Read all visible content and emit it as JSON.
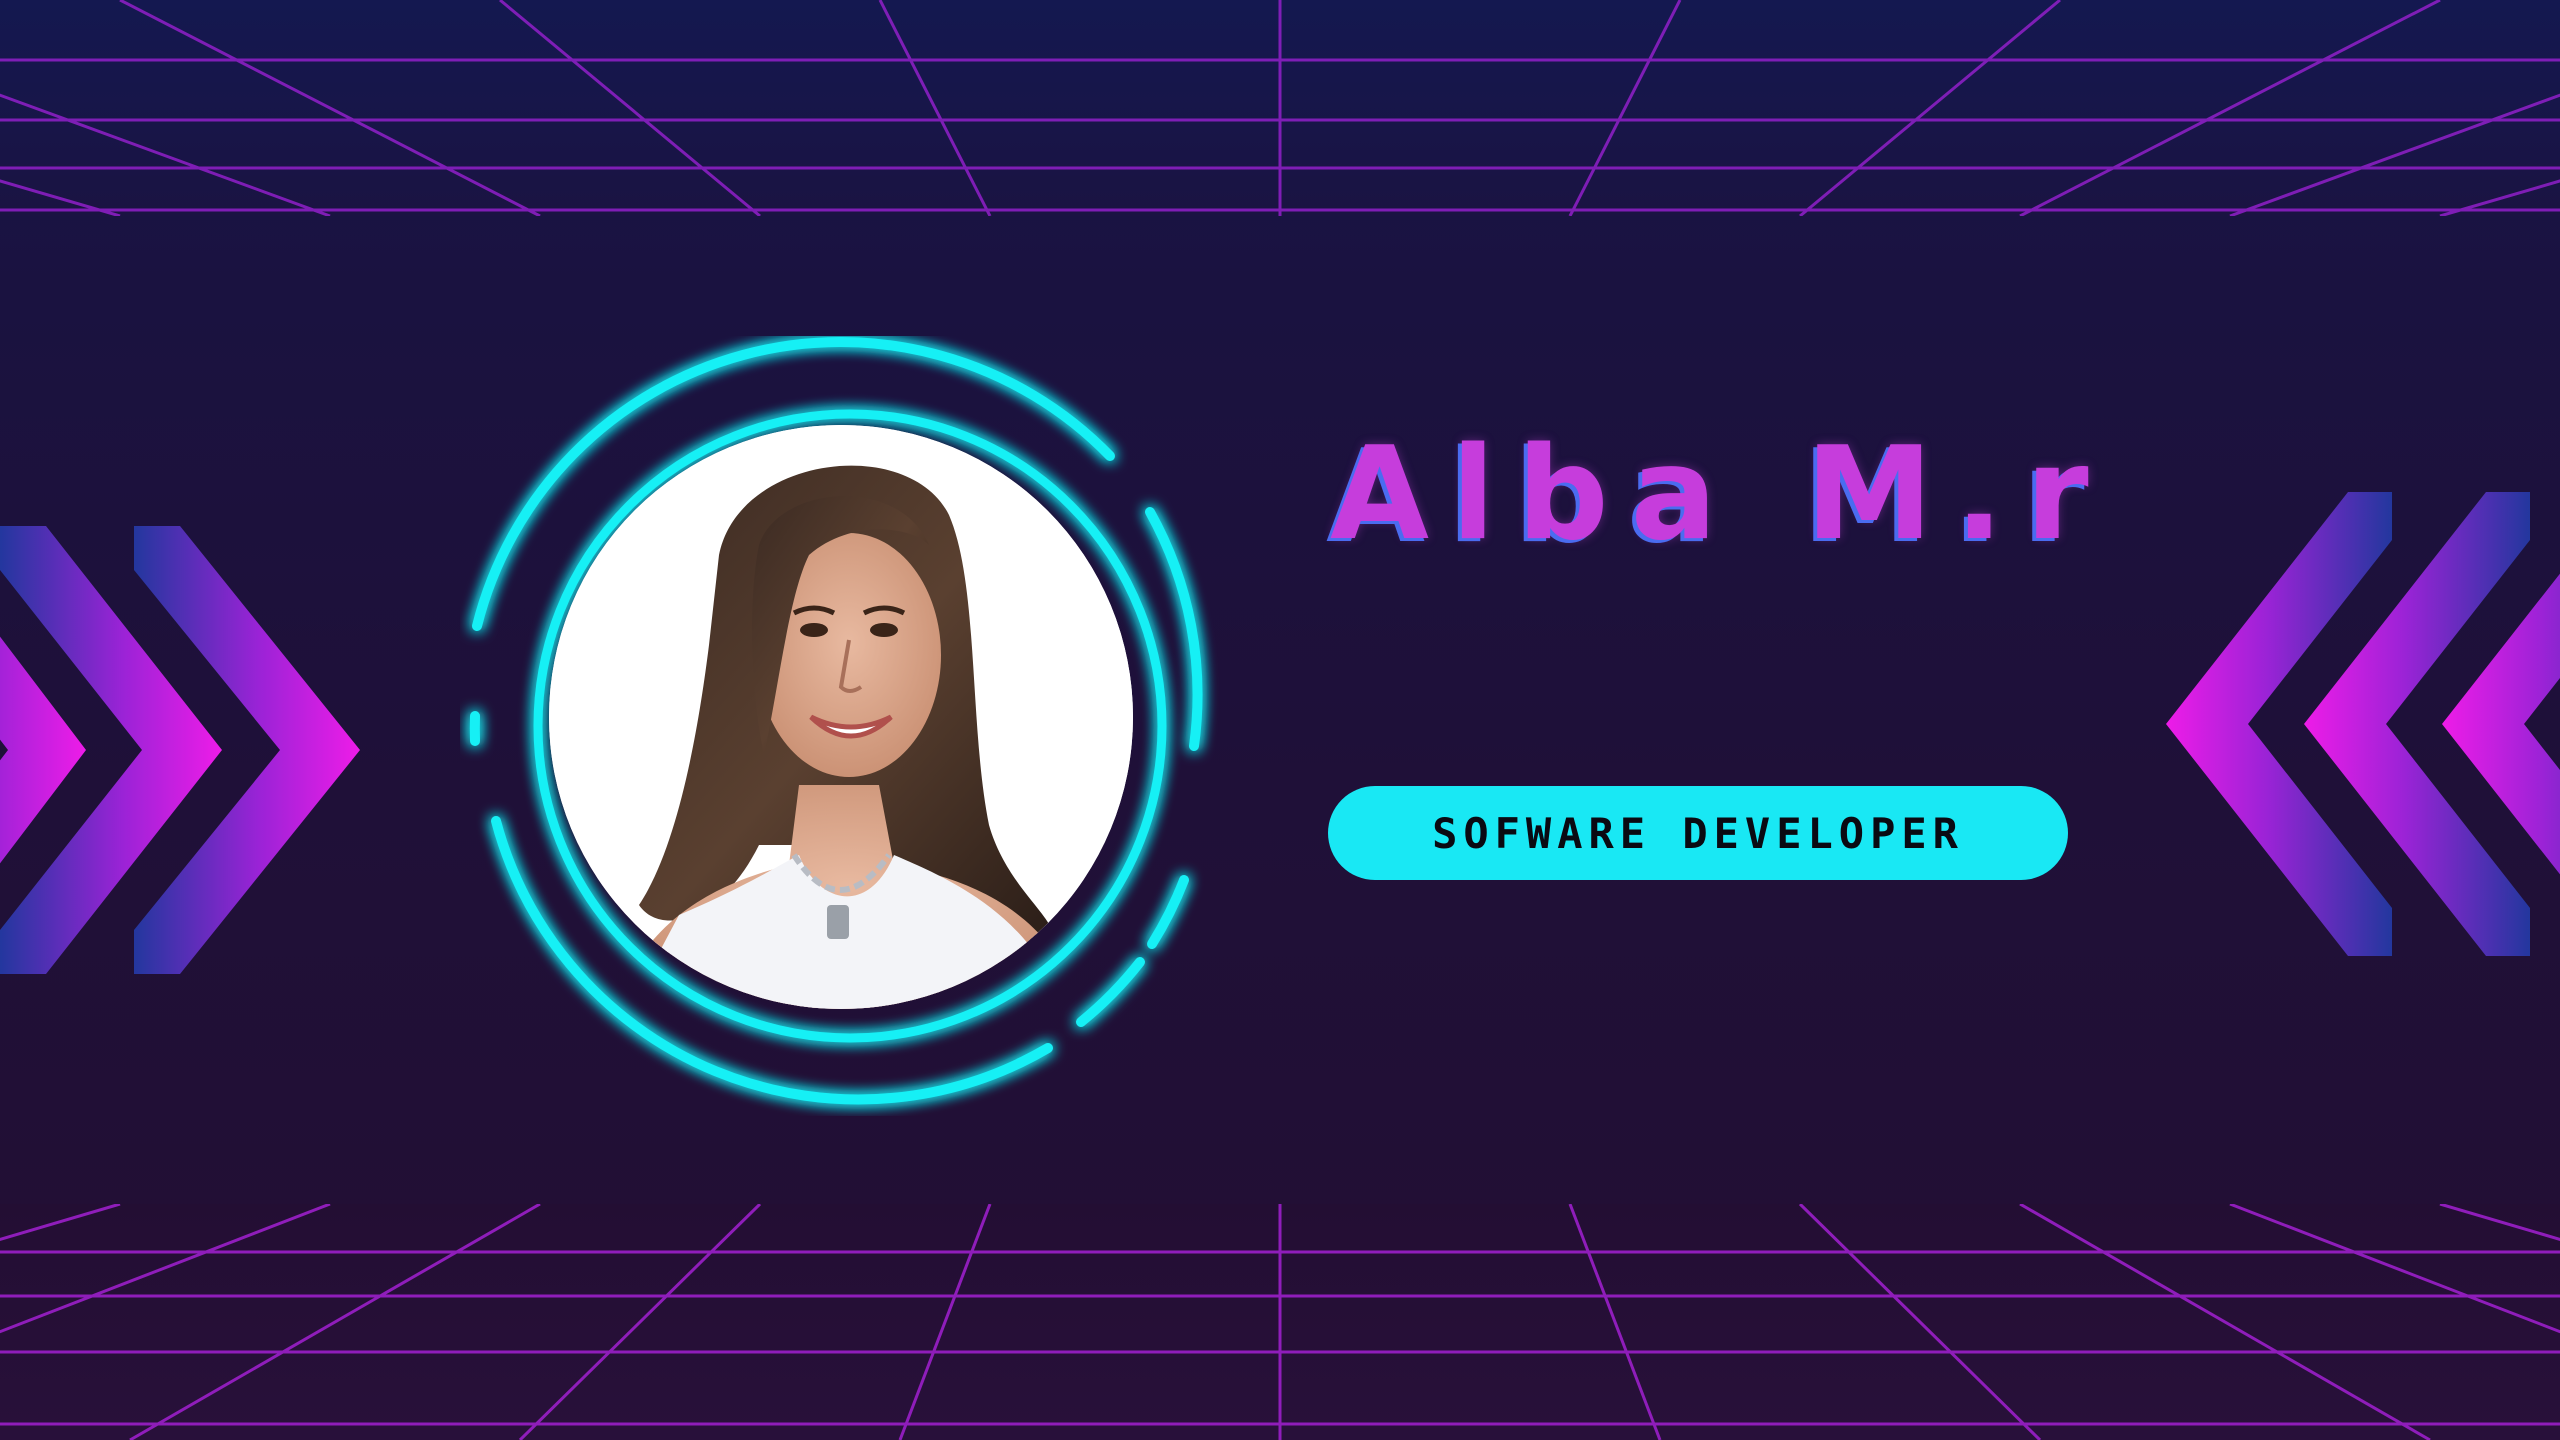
{
  "profile": {
    "name": "Alba M.r",
    "role": "SOFWARE DEVELOPER"
  },
  "colors": {
    "background_top": "#17164a",
    "background_bottom": "#230e33",
    "grid_line": "#9b1fc9",
    "neon_ring": "#19f0f5",
    "name_text": "#c63ddc",
    "pill_background": "#19e8f4",
    "chevron_magenta": "#e31fe8",
    "chevron_blue": "#243aa0"
  },
  "icons": {
    "left_decoration": "chevrons-right-icon",
    "right_decoration": "chevrons-left-icon"
  }
}
